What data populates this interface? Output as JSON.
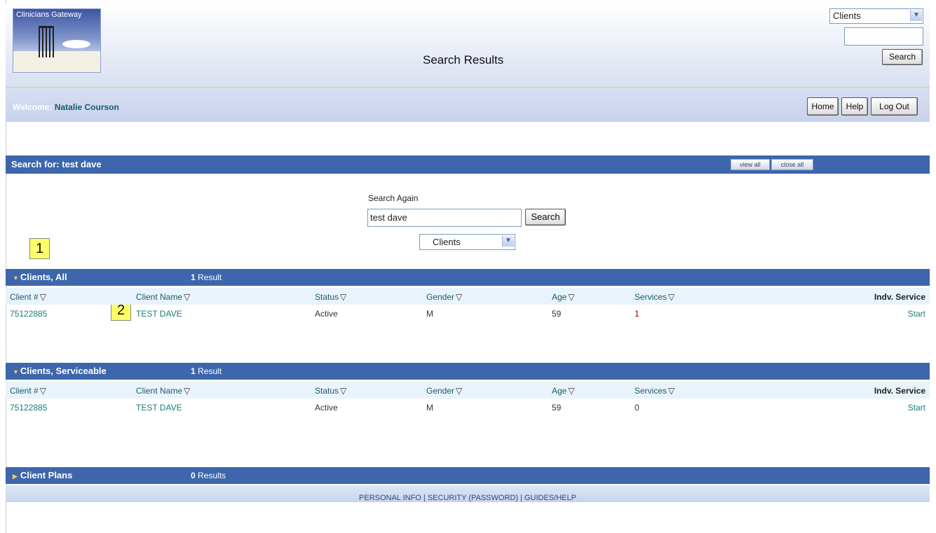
{
  "header": {
    "logo_text": "Clinicians Gateway",
    "page_title": "Search Results",
    "top_select": "Clients",
    "top_search_value": "",
    "top_search_button": "Search",
    "welcome_label": "Welcome:",
    "user_name": "Natalie Courson",
    "nav": [
      "Home",
      "Help",
      "Log Out"
    ]
  },
  "search_bar": {
    "label": "Search for: test dave",
    "view_all": "view all",
    "close_all": "close all"
  },
  "search_again": {
    "label": "Search Again",
    "value": "test dave",
    "button": "Search",
    "select": "Clients"
  },
  "callouts": [
    "1",
    "2"
  ],
  "columns": [
    "Client #",
    "Client Name",
    "Status",
    "Gender",
    "Age",
    "Services",
    "Indv. Service"
  ],
  "sections": [
    {
      "title": "Clients, All",
      "count": "1",
      "count_label": "Result",
      "expanded": true,
      "rows": [
        {
          "client_no": "75122885",
          "name": "TEST DAVE",
          "status": "Active",
          "gender": "M",
          "age": "59",
          "services": "1",
          "action": "Start"
        }
      ]
    },
    {
      "title": "Clients, Serviceable",
      "count": "1",
      "count_label": "Result",
      "expanded": true,
      "rows": [
        {
          "client_no": "75122885",
          "name": "TEST DAVE",
          "status": "Active",
          "gender": "M",
          "age": "59",
          "services": "0",
          "action": "Start"
        }
      ]
    },
    {
      "title": "Client Plans",
      "count": "0",
      "count_label": "Results",
      "expanded": false,
      "rows": []
    }
  ],
  "footer": {
    "links": [
      "PERSONAL INFO",
      "SECURITY (PASSWORD)",
      "GUIDES/HELP"
    ],
    "separator": "|"
  },
  "colors": {
    "section_blue": "#3d66ac",
    "link_teal": "#187a7a",
    "callout_yellow": "#ffff66"
  }
}
